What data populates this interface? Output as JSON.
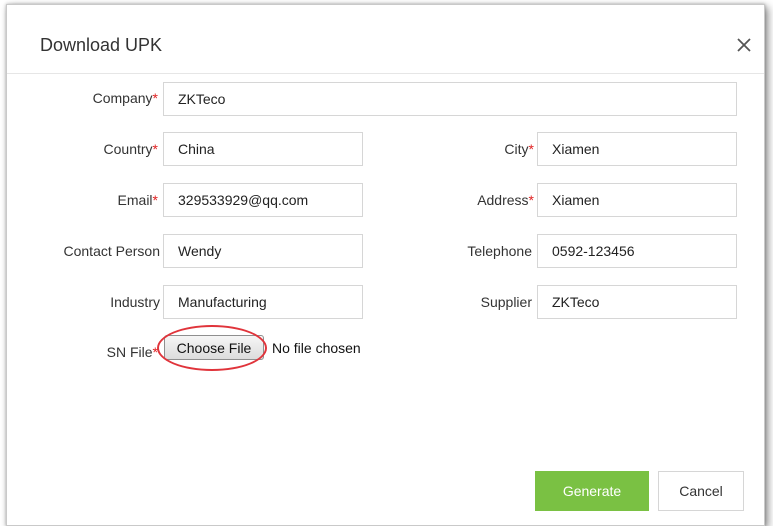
{
  "dialog": {
    "title": "Download UPK",
    "close_icon": "close-icon"
  },
  "form": {
    "required_mark": "*",
    "company": {
      "label": "Company",
      "required": true,
      "value": "ZKTeco"
    },
    "country": {
      "label": "Country",
      "required": true,
      "value": "China"
    },
    "city": {
      "label": "City",
      "required": true,
      "value": "Xiamen"
    },
    "email": {
      "label": "Email",
      "required": true,
      "value": "329533929@qq.com"
    },
    "address": {
      "label": "Address",
      "required": true,
      "value": "Xiamen"
    },
    "contact_person": {
      "label": "Contact Person",
      "required": false,
      "value": "Wendy"
    },
    "telephone": {
      "label": "Telephone",
      "required": false,
      "value": "0592-123456"
    },
    "industry": {
      "label": "Industry",
      "required": false,
      "value": "Manufacturing"
    },
    "supplier": {
      "label": "Supplier",
      "required": false,
      "value": "ZKTeco"
    },
    "sn_file": {
      "label": "SN File",
      "required": true,
      "button_label": "Choose File",
      "status": "No file chosen"
    }
  },
  "footer": {
    "generate_label": "Generate",
    "cancel_label": "Cancel"
  },
  "colors": {
    "primary_button": "#7ac143",
    "required_asterisk": "#e02020",
    "highlight_circle": "#e0343b"
  }
}
